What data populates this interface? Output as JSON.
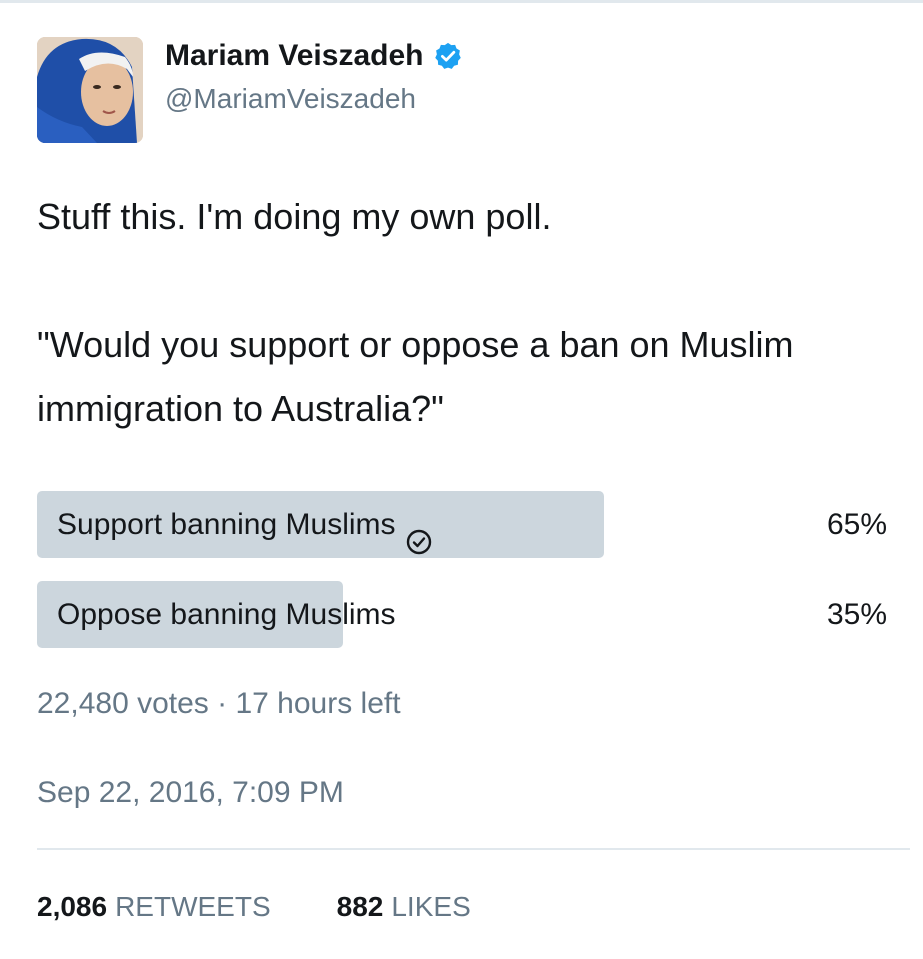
{
  "user": {
    "display_name": "Mariam Veiszadeh",
    "handle": "@MariamVeiszadeh",
    "verified_icon": "verified-badge-icon",
    "verified_color": "#1da1f2"
  },
  "tweet": {
    "line1": "Stuff this. I'm doing my own poll.",
    "line2": "\"Would you support or oppose a ban on Muslim immigration to Australia?\""
  },
  "poll": {
    "options": [
      {
        "label": "Support banning Muslims",
        "percent_text": "65%",
        "percent": 65,
        "selected": true,
        "selected_icon": "check-circle-icon"
      },
      {
        "label": "Oppose banning Muslims",
        "percent_text": "35%",
        "percent": 35,
        "selected": false
      }
    ],
    "bar_color": "#ccd6dd",
    "meta": "22,480 votes · 17 hours left"
  },
  "timestamp": "Sep 22, 2016, 7:09 PM",
  "stats": {
    "retweets_count": "2,086",
    "retweets_label": "RETWEETS",
    "likes_count": "882",
    "likes_label": "LIKES"
  }
}
